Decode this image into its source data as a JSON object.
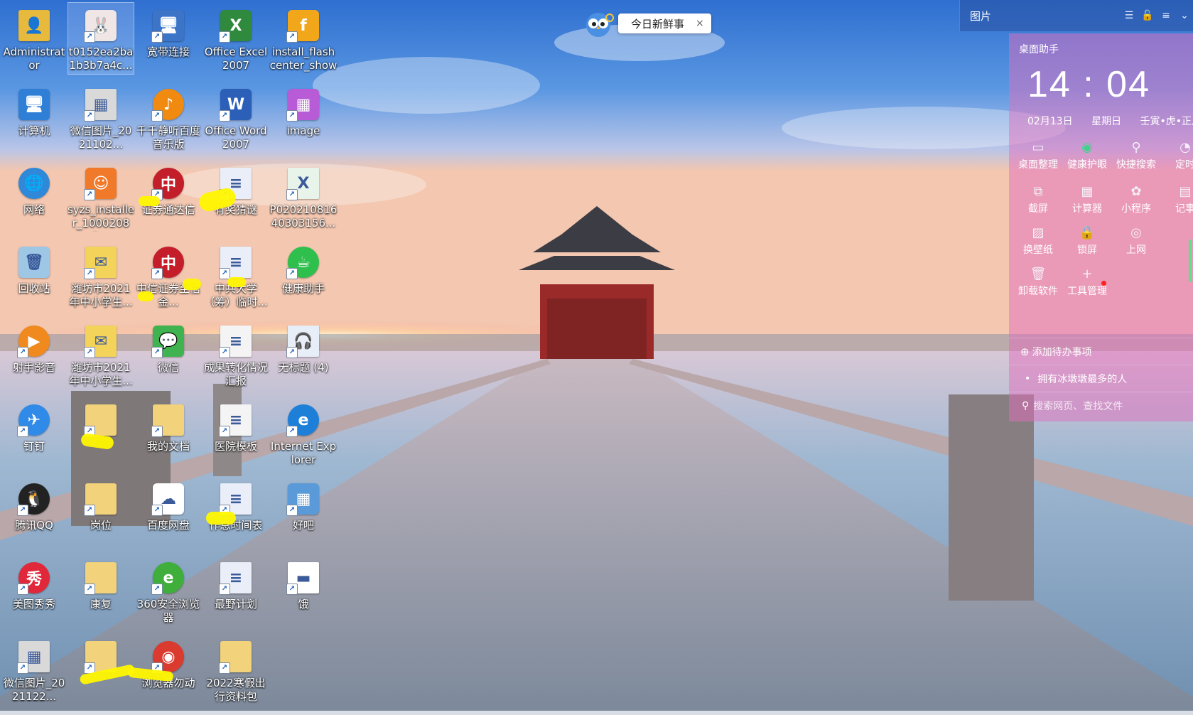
{
  "desktop_icons": [
    {
      "label": "Administrator",
      "icon": "user-folder-icon",
      "color": "#e7b93c",
      "glyph": "👤"
    },
    {
      "label": "t0152ea2ba1b3b7a4c...",
      "icon": "rabbit-image-icon",
      "color": "#f1e6e6",
      "glyph": "🐰"
    },
    {
      "label": "宽带连接",
      "icon": "broadband-connection-icon",
      "color": "#3c74c8",
      "glyph": "🖥"
    },
    {
      "label": "Office Excel 2007",
      "icon": "excel-icon",
      "color": "#2f8a3d",
      "glyph": "X"
    },
    {
      "label": "install_flashcenter_show",
      "icon": "flash-installer-icon",
      "color": "#f2a71b",
      "glyph": "f"
    },
    {
      "label": "计算机",
      "icon": "computer-icon",
      "color": "#2f7fd6",
      "glyph": "🖥"
    },
    {
      "label": "微信图片_2021102...",
      "icon": "image-file-icon",
      "color": "#d9d9d9",
      "glyph": "▦"
    },
    {
      "label": "千千静听百度音乐版",
      "icon": "music-player-icon",
      "color": "#f08a10",
      "glyph": "♪"
    },
    {
      "label": "Office Word 2007",
      "icon": "word-icon",
      "color": "#2b5fb8",
      "glyph": "W"
    },
    {
      "label": "image",
      "icon": "image-thumbnail-icon",
      "color": "#b85bd6",
      "glyph": "▦"
    },
    {
      "label": "网络",
      "icon": "network-icon",
      "color": "#2f88d8",
      "glyph": "🌐"
    },
    {
      "label": "syzs_installer_10002081...",
      "icon": "installer-icon",
      "color": "#f07a2a",
      "glyph": "☺"
    },
    {
      "label": "证券通达信",
      "icon": "securities-app-icon",
      "color": "#c21f2a",
      "glyph": "中"
    },
    {
      "label": "有奖猜谜",
      "icon": "word-document-icon",
      "color": "#e9eef8",
      "glyph": "≡"
    },
    {
      "label": "P020210816 40303156...",
      "icon": "excel-document-icon",
      "color": "#e8f4ea",
      "glyph": "X"
    },
    {
      "label": "回收站",
      "icon": "recycle-bin-icon",
      "color": "#9ec7e6",
      "glyph": "🗑"
    },
    {
      "label": "潍坊市2021年中小学生...",
      "icon": "document-envelope-icon",
      "color": "#f4d35b",
      "glyph": "✉"
    },
    {
      "label": "中信证券至信金...",
      "icon": "citic-securities-icon",
      "color": "#c41e2a",
      "glyph": "中"
    },
    {
      "label": "中共大学（筹）临时...",
      "icon": "word-document-icon",
      "color": "#e9eef8",
      "glyph": "≡"
    },
    {
      "label": "健康助手",
      "icon": "health-assistant-icon",
      "color": "#2fbf4c",
      "glyph": "☕"
    },
    {
      "label": "射手影音",
      "icon": "media-player-icon",
      "color": "#f08a1e",
      "glyph": "▶"
    },
    {
      "label": "潍坊市2021年中小学生...",
      "icon": "document-envelope-icon",
      "color": "#f4d35b",
      "glyph": "✉"
    },
    {
      "label": "微信",
      "icon": "wechat-icon",
      "color": "#3fb34f",
      "glyph": "💬"
    },
    {
      "label": "成果转化情况汇报",
      "icon": "document-thumbnail-icon",
      "color": "#f4f4f4",
      "glyph": "≡"
    },
    {
      "label": "无标题 (4)",
      "icon": "audio-file-icon",
      "color": "#e8eef8",
      "glyph": "🎧"
    },
    {
      "label": "钉钉",
      "icon": "dingtalk-icon",
      "color": "#2f8ae8",
      "glyph": "✈"
    },
    {
      "label": "",
      "icon": "folder-icon",
      "color": "#f2d27a",
      "glyph": ""
    },
    {
      "label": "我的文档",
      "icon": "documents-folder-icon",
      "color": "#f2d27a",
      "glyph": ""
    },
    {
      "label": "医院模板",
      "icon": "template-file-icon",
      "color": "#f4f4f4",
      "glyph": "≡"
    },
    {
      "label": "Internet Explorer",
      "icon": "internet-explorer-icon",
      "color": "#1d7fd8",
      "glyph": "e"
    },
    {
      "label": "腾讯QQ",
      "icon": "qq-icon",
      "color": "#222222",
      "glyph": "🐧"
    },
    {
      "label": "岗位",
      "icon": "folder-icon",
      "color": "#f2d27a",
      "glyph": ""
    },
    {
      "label": "百度网盘",
      "icon": "baidu-netdisk-icon",
      "color": "#ffffff",
      "glyph": "☁"
    },
    {
      "label": "作息时间表",
      "icon": "word-document-icon",
      "color": "#e9eef8",
      "glyph": "≡"
    },
    {
      "label": "好吧",
      "icon": "video-thumbnail-icon",
      "color": "#5a9ad8",
      "glyph": "▦"
    },
    {
      "label": "美图秀秀",
      "icon": "meitu-icon",
      "color": "#e0283a",
      "glyph": "秀"
    },
    {
      "label": "康复",
      "icon": "folder-icon",
      "color": "#f2d27a",
      "glyph": ""
    },
    {
      "label": "360安全浏览器",
      "icon": "360-browser-icon",
      "color": "#3fae3a",
      "glyph": "e"
    },
    {
      "label": "最野计划",
      "icon": "word-document-icon",
      "color": "#e9eef8",
      "glyph": "≡"
    },
    {
      "label": "饿",
      "icon": "flag-file-icon",
      "color": "#ffffff",
      "glyph": "▬"
    },
    {
      "label": "微信图片_2021122...",
      "icon": "image-file-icon",
      "color": "#d9d9d9",
      "glyph": "▦"
    },
    {
      "label": "",
      "icon": "folder-icon",
      "color": "#f2d27a",
      "glyph": ""
    },
    {
      "label": "浏览器勿动",
      "icon": "chrome-icon",
      "color": "#db3a2e",
      "glyph": "◉"
    },
    {
      "label": "2022寒假出行资料包",
      "icon": "folder-icon",
      "color": "#f2d27a",
      "glyph": ""
    }
  ],
  "news_popup": {
    "text": "今日新鲜事",
    "close": "×"
  },
  "picture_bar": {
    "title": "图片",
    "buttons": [
      "☰",
      "🔓",
      "≡",
      "⌄"
    ]
  },
  "assistant": {
    "title": "桌面助手",
    "time": "14 : 04",
    "date": "02月13日",
    "weekday": "星期日",
    "lunar": "壬寅•虎•正月",
    "tools": [
      {
        "label": "桌面整理",
        "icon": "desktop-organize-icon",
        "glyph": "▭"
      },
      {
        "label": "健康护眼",
        "icon": "eye-care-icon",
        "glyph": "◉"
      },
      {
        "label": "快捷搜索",
        "icon": "quick-search-icon",
        "glyph": "⚲"
      },
      {
        "label": "定时",
        "icon": "timer-icon",
        "glyph": "◔"
      },
      {
        "label": "截屏",
        "icon": "screenshot-icon",
        "glyph": "⧉"
      },
      {
        "label": "计算器",
        "icon": "calculator-icon",
        "glyph": "▦"
      },
      {
        "label": "小程序",
        "icon": "mini-program-icon",
        "glyph": "✿"
      },
      {
        "label": "记事",
        "icon": "notes-icon",
        "glyph": "▤"
      },
      {
        "label": "换壁纸",
        "icon": "wallpaper-icon",
        "glyph": "▨"
      },
      {
        "label": "锁屏",
        "icon": "lock-screen-icon",
        "glyph": "🔒"
      },
      {
        "label": "上网",
        "icon": "globe-icon",
        "glyph": "◎"
      },
      {
        "label": "卸载软件",
        "icon": "uninstall-icon",
        "glyph": "🗑"
      },
      {
        "label": "工具管理",
        "icon": "tool-manage-icon",
        "glyph": "+"
      }
    ],
    "add_todo": "添加待办事项",
    "hot_topic": "拥有冰墩墩最多的人",
    "search_placeholder": "搜索网页、查找文件"
  }
}
